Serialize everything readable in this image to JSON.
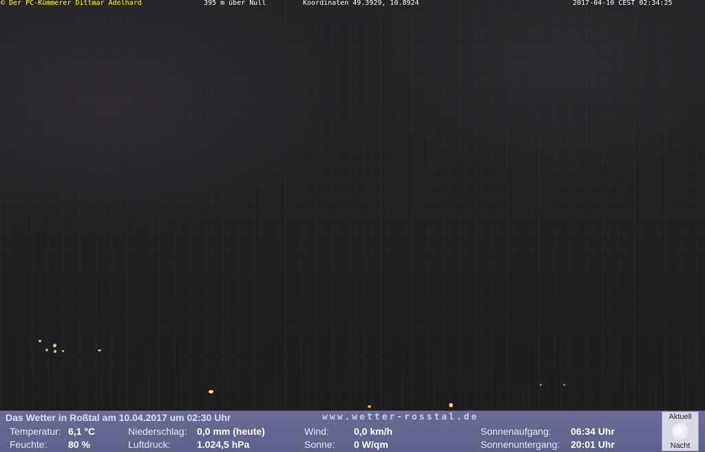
{
  "overlay": {
    "owner": "© Der PC-Kümmerer Dittmar Adelhard",
    "altitude": "395 m über Null",
    "coordinates": "Koordinaten 49.3929, 10.8924",
    "timestamp": "2017-04-10 CEST 02:34:25"
  },
  "weather": {
    "title": "Das Wetter in Roßtal am 10.04.2017 um 02:30 Uhr",
    "website": "www.wetter-rosstal.de",
    "temperature": {
      "label": "Temperatur:",
      "value": "6,1 °C"
    },
    "humidity": {
      "label": "Feuchte:",
      "value": "80 %"
    },
    "precipitation": {
      "label": "Niederschlag:",
      "value": "0,0 mm (heute)"
    },
    "pressure": {
      "label": "Luftdruck:",
      "value": "1.024,5 hPa"
    },
    "wind": {
      "label": "Wind:",
      "value": "0,0 km/h"
    },
    "sun": {
      "label": "Sonne:",
      "value": "0 W/qm"
    },
    "sunrise": {
      "label": "Sonnenaufgang:",
      "value": "06:34 Uhr"
    },
    "sunset": {
      "label": "Sonnenuntergang:",
      "value": "20:01 Uhr"
    }
  },
  "moon": {
    "top_label": "Aktuell",
    "bottom_label": "Nacht",
    "icon": "moon-icon"
  }
}
